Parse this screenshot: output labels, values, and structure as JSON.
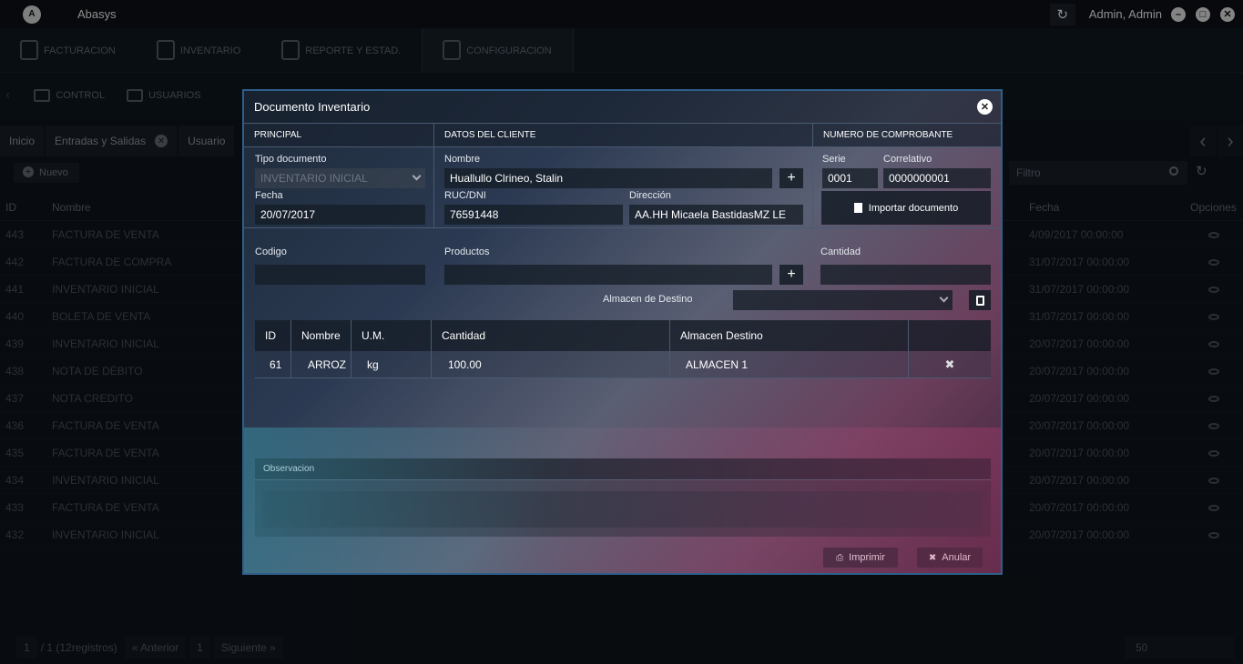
{
  "app": {
    "name": "Abasys",
    "user": "Admin, Admin"
  },
  "nav": {
    "tabs": [
      "FACTURACION",
      "INVENTARIO",
      "REPORTE Y ESTAD.",
      "CONFIGURACION"
    ]
  },
  "subnav": {
    "items": [
      "CONTROL",
      "USUARIOS"
    ]
  },
  "pagetabs": {
    "inicio": "Inicio",
    "entradas": "Entradas y Salidas",
    "usuario": "Usuario"
  },
  "toolbar": {
    "nuevo": "Nuevo",
    "filtro_placeholder": "Filtro"
  },
  "bgtable": {
    "headers": {
      "id": "ID",
      "nombre": "Nombre",
      "fecha": "Fecha",
      "opciones": "Opciones"
    },
    "rows": [
      {
        "id": "443",
        "nombre": "FACTURA DE VENTA",
        "fecha": "4/09/2017 00:00:00"
      },
      {
        "id": "442",
        "nombre": "FACTURA DE COMPRA",
        "fecha": "31/07/2017 00:00:00"
      },
      {
        "id": "441",
        "nombre": "INVENTARIO INICIAL",
        "fecha": "31/07/2017 00:00:00"
      },
      {
        "id": "440",
        "nombre": "BOLETA DE VENTA",
        "fecha": "31/07/2017 00:00:00"
      },
      {
        "id": "439",
        "nombre": "INVENTARIO INICIAL",
        "fecha": "20/07/2017 00:00:00"
      },
      {
        "id": "438",
        "nombre": "NOTA DE DÉBITO",
        "fecha": "20/07/2017 00:00:00"
      },
      {
        "id": "437",
        "nombre": "NOTA CREDITO",
        "fecha": "20/07/2017 00:00:00"
      },
      {
        "id": "436",
        "nombre": "FACTURA DE VENTA",
        "fecha": "20/07/2017 00:00:00"
      },
      {
        "id": "435",
        "nombre": "FACTURA DE VENTA",
        "fecha": "20/07/2017 00:00:00"
      },
      {
        "id": "434",
        "nombre": "INVENTARIO INICIAL",
        "fecha": "20/07/2017 00:00:00"
      },
      {
        "id": "433",
        "nombre": "FACTURA DE VENTA",
        "fecha": "20/07/2017 00:00:00"
      },
      {
        "id": "432",
        "nombre": "INVENTARIO INICIAL",
        "fecha": "20/07/2017 00:00:00"
      }
    ]
  },
  "pager": {
    "page": "1",
    "total": "/ 1 (12registros)",
    "prev": "« Anterior",
    "current": "1",
    "next": "Siguiente »",
    "size": "50"
  },
  "modal": {
    "title": "Documento Inventario",
    "principal": {
      "header": "PRINCIPAL",
      "tipo_label": "Tipo documento",
      "tipo_value": "INVENTARIO INICIAL",
      "fecha_label": "Fecha",
      "fecha_value": "20/07/2017"
    },
    "cliente": {
      "header": "DATOS DEL CLIENTE",
      "nombre_label": "Nombre",
      "nombre_value": "Huallullo Clrineo, Stalin",
      "ruc_label": "RUC/DNI",
      "ruc_value": "76591448",
      "dir_label": "Dirección",
      "dir_value": "AA.HH Micaela BastidasMZ LE"
    },
    "comprobante": {
      "header": "NUMERO DE COMPROBANTE",
      "serie_label": "Serie",
      "serie_value": "0001",
      "corr_label": "Correlativo",
      "corr_value": "0000000001",
      "importar": "Importar documento"
    },
    "productos": {
      "codigo_label": "Codigo",
      "productos_label": "Productos",
      "cantidad_label": "Cantidad",
      "almacen_label": "Almacen de Destino"
    },
    "grid": {
      "headers": [
        "ID",
        "Nombre",
        "U.M.",
        "Cantidad",
        "Almacen Destino"
      ],
      "rows": [
        {
          "id": "61",
          "nombre": "ARROZ",
          "um": "kg",
          "cantidad": "100.00",
          "almacen": "ALMACEN 1"
        }
      ]
    },
    "obs_label": "Observacion",
    "imprimir": "Imprimir",
    "anular": "Anular"
  }
}
